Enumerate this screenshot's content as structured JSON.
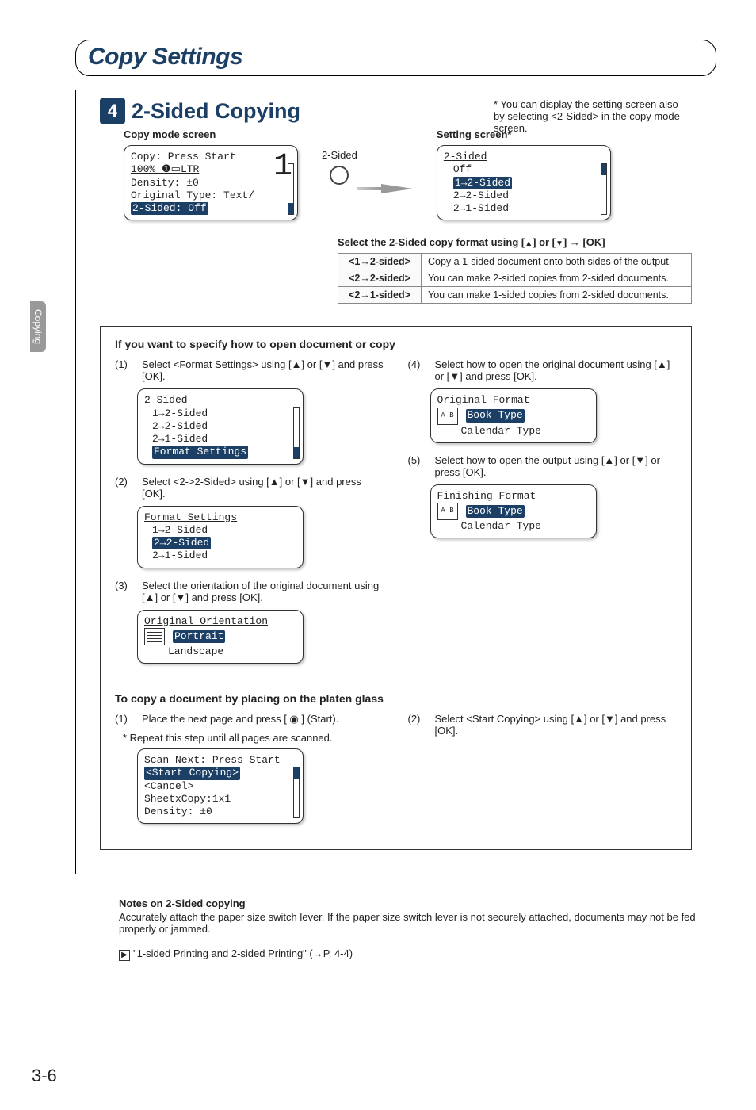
{
  "page": {
    "title": "Copy Settings",
    "number": "3-6"
  },
  "sidebar": {
    "label": "Copying"
  },
  "section": {
    "badge": "4",
    "title": "2-Sided Copying",
    "footnote": "* You can display the setting screen also by selecting <2-Sided> in the copy mode screen."
  },
  "copy_screen": {
    "label": "Copy mode screen",
    "line1": "Copy: Press Start",
    "line2": "100% ❶▭LTR",
    "big": "1",
    "line3": "Density: ±0",
    "line4": "Original Type: Text/",
    "line5": "2-Sided: Off"
  },
  "button": {
    "label": "2-Sided"
  },
  "setting_screen": {
    "label": "Setting screen*",
    "header": "2-Sided",
    "opt0": "Off",
    "opt1": "1→2-Sided",
    "opt2": "2→2-Sided",
    "opt3": "2→1-Sided"
  },
  "select_line": {
    "prefix": "Select the 2-Sided copy format using [",
    "mid": "] or [",
    "suffix": "]  → [OK]"
  },
  "modes": {
    "r1k": "<1→2-sided>",
    "r1v": "Copy a 1-sided document onto both sides of the output.",
    "r2k": "<2→2-sided>",
    "r2v": "You can make 2-sided copies from 2-sided documents.",
    "r3k": "<2→1-sided>",
    "r3v": "You can make 1-sided copies from 2-sided documents."
  },
  "format_box": {
    "title": "If you want to specify how to open document or copy",
    "s1_num": "(1)",
    "s1": "Select <Format Settings> using [▲] or [▼] and press [OK].",
    "lcd1": {
      "h": "2-Sided",
      "a": "1→2-Sided",
      "b": "2→2-Sided",
      "c": "2→1-Sided",
      "d": "Format Settings"
    },
    "s2_num": "(2)",
    "s2": "Select <2->2-Sided> using [▲] or [▼] and press [OK].",
    "lcd2": {
      "h": "Format Settings",
      "a": "1→2-Sided",
      "b": "2→2-Sided",
      "c": "2→1-Sided"
    },
    "s3_num": "(3)",
    "s3": "Select the orientation of the original document using [▲] or [▼] and press [OK].",
    "lcd3": {
      "h": "Original Orientation",
      "a": "Portrait",
      "b": "Landscape"
    },
    "s4_num": "(4)",
    "s4": "Select how to open the original document using [▲] or [▼] and press [OK].",
    "lcd4": {
      "h": "Original Format",
      "a": "Book Type",
      "b": "Calendar Type"
    },
    "s5_num": "(5)",
    "s5": "Select how to open the output using [▲] or [▼] or press [OK].",
    "lcd5": {
      "h": "Finishing Format",
      "a": "Book Type",
      "b": "Calendar Type"
    }
  },
  "platen": {
    "title": "To copy a document by placing on the platen glass",
    "s1_num": "(1)",
    "s1": "Place the next page and press [ ◉ ] (Start).",
    "s1_note": "*  Repeat this step until all pages are scanned.",
    "lcd": {
      "h": "Scan Next: Press Start",
      "a": "<Start Copying>",
      "b": "<Cancel>",
      "c": "SheetxCopy:1x1",
      "d": "Density: ±0"
    },
    "s2_num": "(2)",
    "s2": "Select <Start Copying> using [▲] or [▼] and press [OK]."
  },
  "notes": {
    "title": "Notes on 2-Sided copying",
    "body": "Accurately attach the paper size switch lever. If the paper size switch lever is not securely attached, documents may not be fed properly or jammed.",
    "ref": "\"1-sided Printing and 2-sided Printing\" (→P. 4-4)"
  }
}
